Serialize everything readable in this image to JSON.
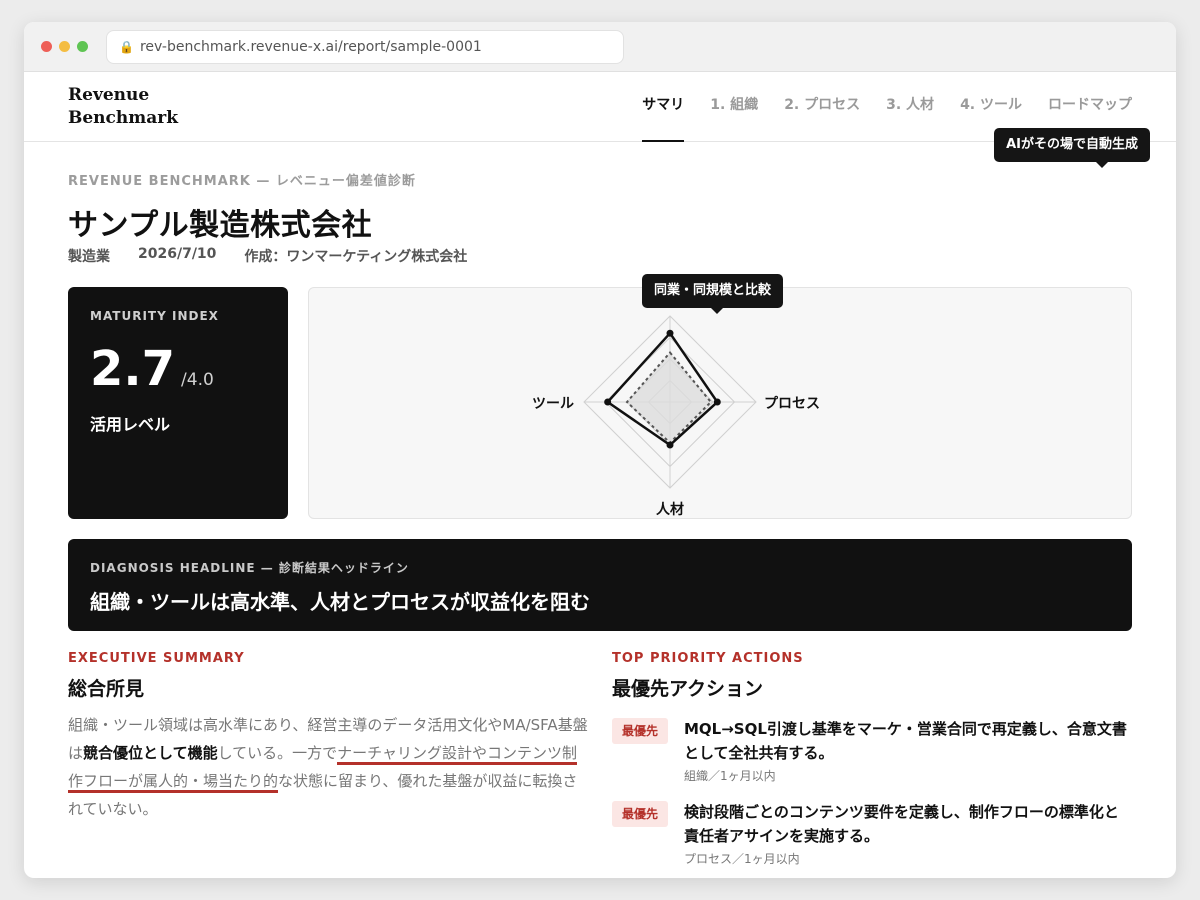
{
  "browser": {
    "url": "rev-benchmark.revenue-x.ai/report/sample-0001"
  },
  "brand": {
    "line1": "Revenue",
    "line2": "Benchmark"
  },
  "nav": {
    "tabs": [
      {
        "label": "サマリ",
        "active": true
      },
      {
        "label": "1. 組織",
        "active": false
      },
      {
        "label": "2. プロセス",
        "active": false
      },
      {
        "label": "3. 人材",
        "active": false
      },
      {
        "label": "4. ツール",
        "active": false
      },
      {
        "label": "ロードマップ",
        "active": false
      }
    ],
    "ai_tooltip": "AIがその場で自動生成"
  },
  "report": {
    "eyebrow": "REVENUE BENCHMARK — レベニュー偏差値診断",
    "company": "サンプル製造株式会社",
    "industry": "製造業",
    "date": "2026/7/10",
    "author": "作成：ワンマーケティング株式会社"
  },
  "maturity": {
    "label": "MATURITY INDEX",
    "score": "2.7",
    "max": "/4.0",
    "level": "活用レベル"
  },
  "radar": {
    "tooltip": "同業・同規模と比較",
    "axes": {
      "top": "",
      "right": "プロセス",
      "bottom": "人材",
      "left": "ツール"
    },
    "max": 4,
    "rings": 4,
    "company": {
      "top": 3.2,
      "right": 2.2,
      "bottom": 2.0,
      "left": 2.9
    },
    "peer": {
      "top": 2.3,
      "right": 1.9,
      "bottom": 1.9,
      "left": 2.0
    },
    "colors": {
      "company": "#111111",
      "peer": "#555555",
      "grid": "#d0d0d0",
      "fill": "#dcdcdc"
    }
  },
  "headline": {
    "eyebrow": "DIAGNOSIS HEADLINE — 診断結果ヘッドライン",
    "text": "組織・ツールは高水準、人材とプロセスが収益化を阻む"
  },
  "summary": {
    "eyebrow": "EXECUTIVE SUMMARY",
    "title": "総合所見",
    "p1": "組織・ツール領域は高水準にあり、経営主導のデータ活用文化やMA/SFA基盤は",
    "p2": "競合優位として機能",
    "p3": "している。一方で",
    "p4": "ナーチャリング設計やコンテンツ制作フローが属人的・場当たり的",
    "p5": "な状態に留まり、優れた基盤が収益に転換されていない。"
  },
  "actions": {
    "eyebrow": "TOP PRIORITY ACTIONS",
    "title": "最優先アクション",
    "items": [
      {
        "badge": "最優先",
        "title": "MQL→SQL引渡し基準をマーケ・営業合同で再定義し、合意文書として全社共有する。",
        "meta": "組織／1ヶ月以内"
      },
      {
        "badge": "最優先",
        "title": "検討段階ごとのコンテンツ要件を定義し、制作フローの標準化と責任者アサインを実施する。",
        "meta": "プロセス／1ヶ月以内"
      }
    ]
  }
}
